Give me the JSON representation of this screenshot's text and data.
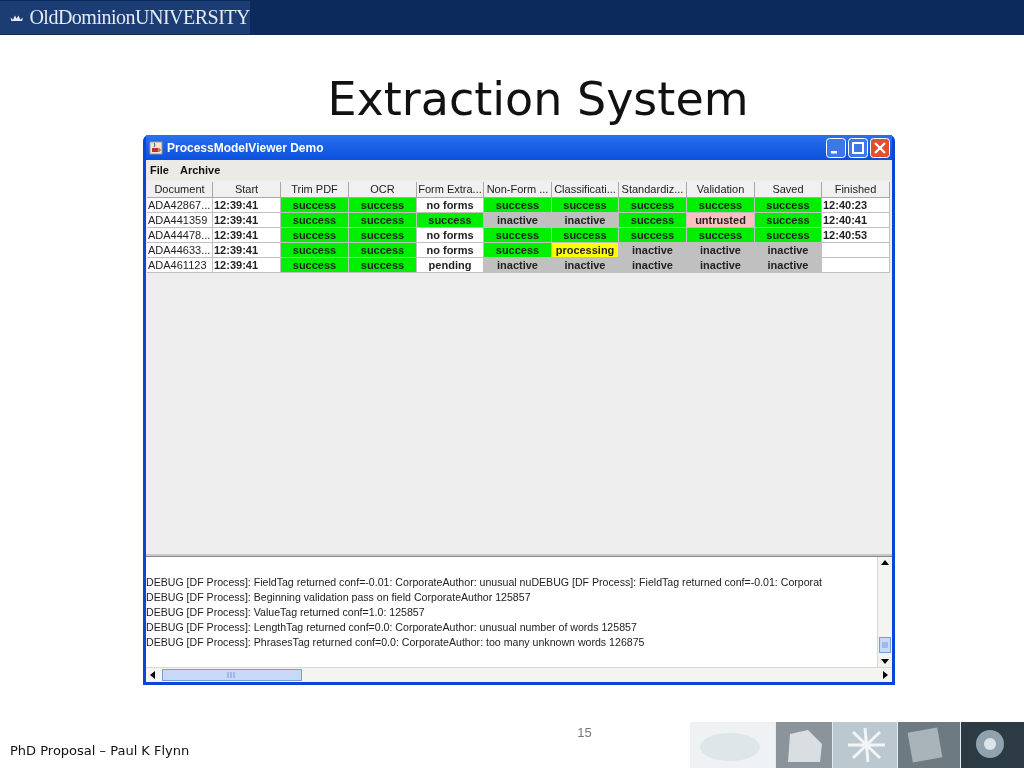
{
  "header": {
    "logo_text": "OldDominionUNIVERSITY"
  },
  "slide": {
    "title": "Extraction System"
  },
  "window": {
    "title": "ProcessModelViewer Demo",
    "menu": [
      "File",
      "Archive"
    ],
    "table": {
      "columns": [
        "Document",
        "Start",
        "Trim PDF",
        "OCR",
        "Form Extra...",
        "Non-Form ...",
        "Classificati...",
        "Standardiz...",
        "Validation",
        "Saved",
        "Finished"
      ],
      "rows": [
        [
          {
            "text": "ADA42867...",
            "kind": "name"
          },
          {
            "text": "12:39:41",
            "kind": "time"
          },
          {
            "text": "success",
            "kind": "success"
          },
          {
            "text": "success",
            "kind": "success"
          },
          {
            "text": "no forms",
            "kind": "plain"
          },
          {
            "text": "success",
            "kind": "success"
          },
          {
            "text": "success",
            "kind": "success"
          },
          {
            "text": "success",
            "kind": "success"
          },
          {
            "text": "success",
            "kind": "success"
          },
          {
            "text": "success",
            "kind": "success"
          },
          {
            "text": "12:40:23",
            "kind": "time"
          }
        ],
        [
          {
            "text": "ADA441359",
            "kind": "name"
          },
          {
            "text": "12:39:41",
            "kind": "time"
          },
          {
            "text": "success",
            "kind": "success"
          },
          {
            "text": "success",
            "kind": "success"
          },
          {
            "text": "success",
            "kind": "success"
          },
          {
            "text": "inactive",
            "kind": "inactive"
          },
          {
            "text": "inactive",
            "kind": "inactive"
          },
          {
            "text": "success",
            "kind": "success"
          },
          {
            "text": "untrusted",
            "kind": "untrusted"
          },
          {
            "text": "success",
            "kind": "success"
          },
          {
            "text": "12:40:41",
            "kind": "time"
          }
        ],
        [
          {
            "text": "ADA44478...",
            "kind": "name"
          },
          {
            "text": "12:39:41",
            "kind": "time"
          },
          {
            "text": "success",
            "kind": "success"
          },
          {
            "text": "success",
            "kind": "success"
          },
          {
            "text": "no forms",
            "kind": "plain"
          },
          {
            "text": "success",
            "kind": "success"
          },
          {
            "text": "success",
            "kind": "success"
          },
          {
            "text": "success",
            "kind": "success"
          },
          {
            "text": "success",
            "kind": "success"
          },
          {
            "text": "success",
            "kind": "success"
          },
          {
            "text": "12:40:53",
            "kind": "time"
          }
        ],
        [
          {
            "text": "ADA44633...",
            "kind": "name"
          },
          {
            "text": "12:39:41",
            "kind": "time"
          },
          {
            "text": "success",
            "kind": "success"
          },
          {
            "text": "success",
            "kind": "success"
          },
          {
            "text": "no forms",
            "kind": "plain"
          },
          {
            "text": "success",
            "kind": "success"
          },
          {
            "text": "processing",
            "kind": "processing"
          },
          {
            "text": "inactive",
            "kind": "inactive"
          },
          {
            "text": "inactive",
            "kind": "inactive"
          },
          {
            "text": "inactive",
            "kind": "inactive"
          },
          {
            "kind": "empty"
          }
        ],
        [
          {
            "text": "ADA461123",
            "kind": "name"
          },
          {
            "text": "12:39:41",
            "kind": "time"
          },
          {
            "text": "success",
            "kind": "success"
          },
          {
            "text": "success",
            "kind": "success"
          },
          {
            "text": "pending",
            "kind": "plain"
          },
          {
            "text": "inactive",
            "kind": "inactive"
          },
          {
            "text": "inactive",
            "kind": "inactive"
          },
          {
            "text": "inactive",
            "kind": "inactive"
          },
          {
            "text": "inactive",
            "kind": "inactive"
          },
          {
            "text": "inactive",
            "kind": "inactive"
          },
          {
            "kind": "empty"
          }
        ]
      ]
    },
    "log": [
      "DEBUG [DF Process]: FieldTag returned conf=-0.01: CorporateAuthor: unusual nuDEBUG [DF Process]: FieldTag returned conf=-0.01: Corporat",
      "DEBUG [DF Process]: Beginning validation pass on field CorporateAuthor  125857",
      "DEBUG [DF Process]: ValueTag returned conf=1.0:   125857",
      "DEBUG [DF Process]: LengthTag returned conf=0.0: CorporateAuthor: unusual number of words  125857",
      "DEBUG [DF Process]: PhrasesTag returned conf=0.0: CorporateAuthor: too many unknown words  126875"
    ]
  },
  "footer": {
    "page_number": "15",
    "author": "PhD Proposal – Paul K Flynn"
  }
}
